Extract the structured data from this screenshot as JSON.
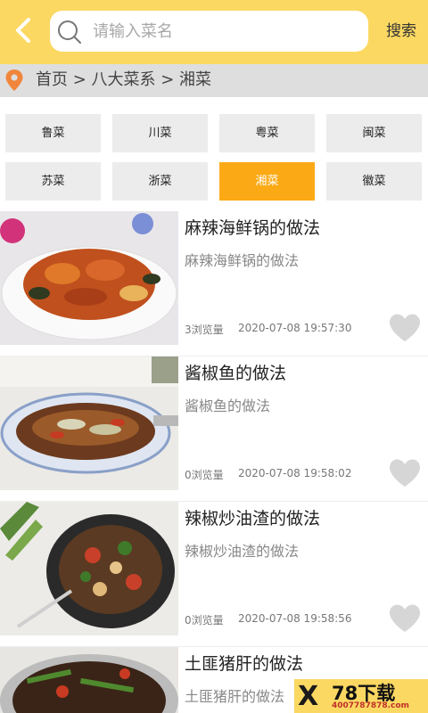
{
  "header": {
    "search_placeholder": "请输入菜名",
    "search_button": "搜索"
  },
  "breadcrumb": {
    "text": "首页 > 八大菜系 > 湘菜"
  },
  "categories": [
    {
      "label": "鲁菜",
      "active": false
    },
    {
      "label": "川菜",
      "active": false
    },
    {
      "label": "粤菜",
      "active": false
    },
    {
      "label": "闽菜",
      "active": false
    },
    {
      "label": "苏菜",
      "active": false
    },
    {
      "label": "浙菜",
      "active": false
    },
    {
      "label": "湘菜",
      "active": true
    },
    {
      "label": "徽菜",
      "active": false
    }
  ],
  "recipes": [
    {
      "title": "麻辣海鲜锅的做法",
      "desc": "麻辣海鲜锅的做法",
      "views": "3浏览量",
      "time": "2020-07-08 19:57:30"
    },
    {
      "title": "酱椒鱼的做法",
      "desc": "酱椒鱼的做法",
      "views": "0浏览量",
      "time": "2020-07-08 19:58:02"
    },
    {
      "title": "辣椒炒油渣的做法",
      "desc": "辣椒炒油渣的做法",
      "views": "0浏览量",
      "time": "2020-07-08 19:58:56"
    },
    {
      "title": "土匪猪肝的做法",
      "desc": "土匪猪肝的做法",
      "views": "",
      "time": ""
    }
  ],
  "watermark": {
    "brand": "78下载",
    "url": "4007787878.com"
  },
  "colors": {
    "header_bg": "#fbd862",
    "active_category": "#fbaa16",
    "location_pin": "#f0863c",
    "heart": "#d6d6d6"
  },
  "icons": {
    "back": "back-chevron-icon",
    "search": "search-icon",
    "location": "location-pin-icon",
    "like": "heart-icon"
  }
}
